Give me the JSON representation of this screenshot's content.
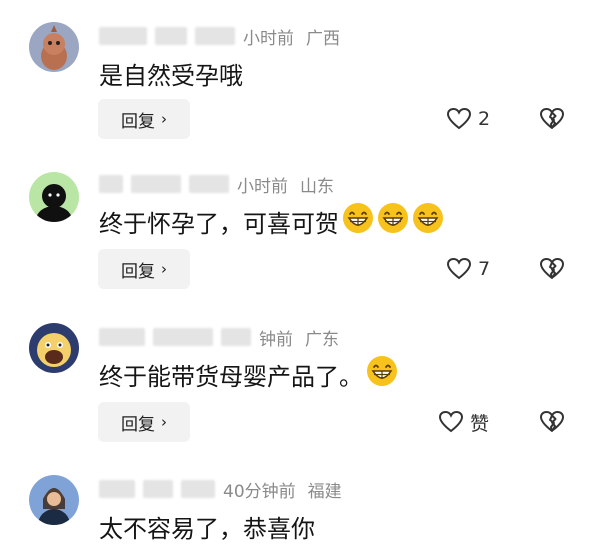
{
  "comments": [
    {
      "time": "小时前",
      "location": "广西",
      "text": "是自然受孕哦",
      "emojis": [],
      "reply_label": "回复",
      "like_count": "2"
    },
    {
      "time": "小时前",
      "location": "山东",
      "text": "终于怀孕了，可喜可贺",
      "emojis": [
        "grinning-emoji",
        "grinning-emoji",
        "grinning-emoji"
      ],
      "reply_label": "回复",
      "like_count": "7"
    },
    {
      "time": "钟前",
      "location": "广东",
      "text": "终于能带货母婴产品了。",
      "emojis": [
        "grinning-emoji"
      ],
      "reply_label": "回复",
      "like_count": "赞"
    },
    {
      "time": "40分钟前",
      "location": "福建",
      "text": "太不容易了，恭喜你",
      "emojis": []
    }
  ],
  "colors": {
    "text": "#151515",
    "meta": "#8a8a8a",
    "reply_bg": "#f2f2f2",
    "emoji": "#f8c21c"
  }
}
